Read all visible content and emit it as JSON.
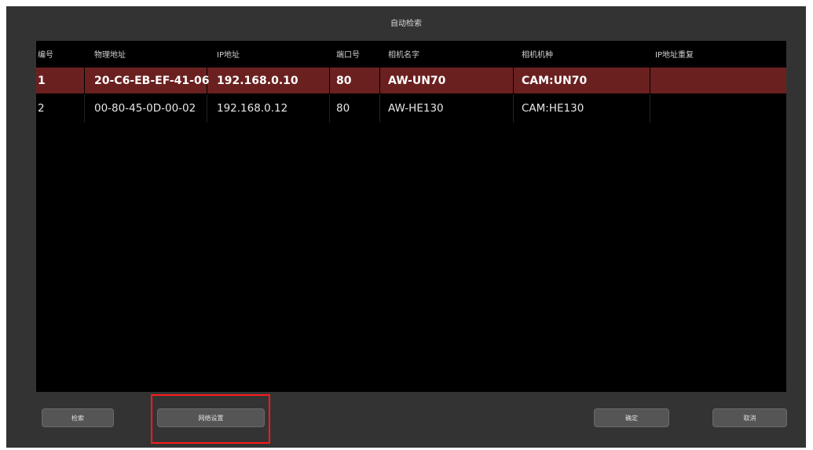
{
  "dialog": {
    "title": "自动检索"
  },
  "table": {
    "columns": [
      "编号",
      "物理地址",
      "IP地址",
      "端口号",
      "相机名字",
      "相机机种",
      "IP地址重复"
    ],
    "rows": [
      [
        "1",
        "20-C6-EB-EF-41-06",
        "192.168.0.10",
        "80",
        "AW-UN70",
        "CAM:UN70",
        ""
      ],
      [
        "2",
        "00-80-45-0D-00-02",
        "192.168.0.12",
        "80",
        "AW-HE130",
        "CAM:HE130",
        ""
      ]
    ],
    "selected_row": 0
  },
  "buttons": {
    "search": "检索",
    "network_settings": "网络设置",
    "ok": "确定",
    "cancel": "取消"
  },
  "colors": {
    "dialog_bg": "#333333",
    "table_bg": "#000000",
    "selected_row_bg": "#6b2020",
    "button_bg": "#555555",
    "highlight": "#ff1a1a"
  }
}
